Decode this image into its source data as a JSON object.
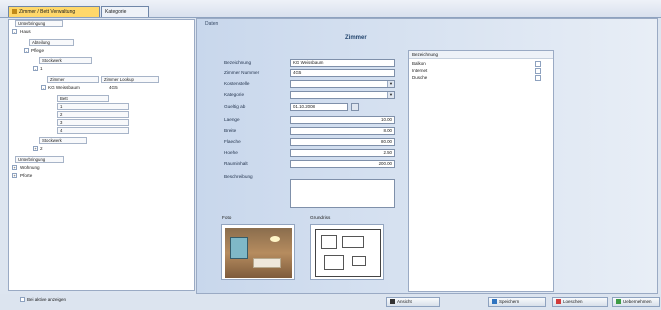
{
  "tabs": [
    {
      "label": "Zimmer / Bett Verwaltung"
    },
    {
      "label": "Kategorie"
    }
  ],
  "tree": {
    "top_label": "Unterbringung",
    "nodes": [
      {
        "label": "Haus"
      },
      {
        "label": "Abteilung"
      },
      {
        "label": "Pflege"
      },
      {
        "label": "Stockwerk"
      },
      {
        "label": "1"
      },
      {
        "label": "Zimmer"
      },
      {
        "label": "Zimmer Lookup"
      },
      {
        "label": "KG Weissbaum"
      },
      {
        "label": "4G5"
      },
      {
        "label": "Bett"
      },
      {
        "label": "1"
      },
      {
        "label": "2"
      },
      {
        "label": "3"
      },
      {
        "label": "4"
      },
      {
        "label": "Stockwerk"
      },
      {
        "label": "2"
      },
      {
        "label": "Unterbringung"
      },
      {
        "label": "Wohnung"
      },
      {
        "label": "Pforte"
      }
    ]
  },
  "form": {
    "header": "Daten",
    "title": "Zimmer",
    "fields": [
      {
        "label": "Bezeichnung",
        "value": "KG Weissbaum"
      },
      {
        "label": "Zimmer Nummer",
        "value": "4G5"
      },
      {
        "label": "Kostenstelle",
        "value": ""
      },
      {
        "label": "Kategorie",
        "value": ""
      },
      {
        "label": "Gueltig ab",
        "value": "01.10.2008"
      },
      {
        "label": "Laenge",
        "value": "10.00"
      },
      {
        "label": "Breite",
        "value": "8.00"
      },
      {
        "label": "Flaeche",
        "value": "80.00"
      },
      {
        "label": "Hoehe",
        "value": "2.50"
      },
      {
        "label": "Rauminhalt",
        "value": "200.00"
      },
      {
        "label": "Beschreibung",
        "value": ""
      }
    ],
    "foto_label": "Foto",
    "grundriss_label": "Grundriss"
  },
  "list": {
    "header": "Bezeichnung",
    "rows": [
      {
        "label": "Balkon"
      },
      {
        "label": "Internet"
      },
      {
        "label": "Dusche"
      }
    ]
  },
  "footer": {
    "checkbox_label": "Bei aktive anzeigen",
    "buttons": [
      {
        "label": "Ansicht"
      },
      {
        "label": "Speichern"
      },
      {
        "label": "Loeschen"
      },
      {
        "label": "Uebernehmen"
      }
    ]
  }
}
